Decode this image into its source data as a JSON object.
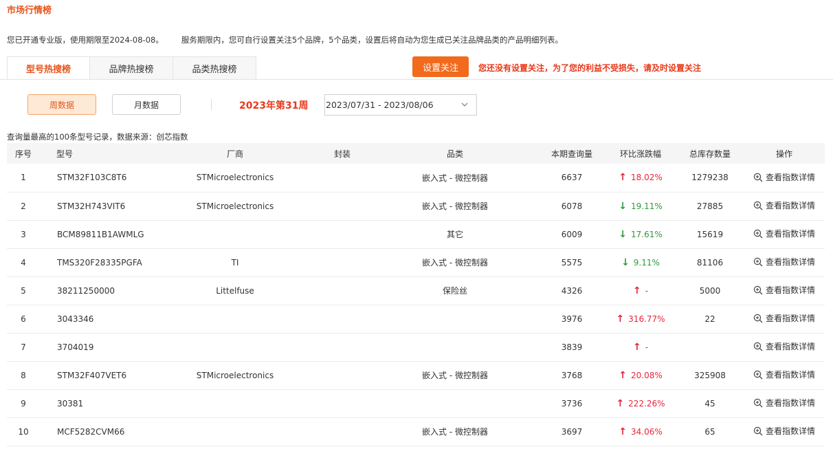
{
  "page_title": "市场行情榜",
  "notice": {
    "left": "您已开通专业版，使用期限至2024-08-08。",
    "right": "服务期限内，您可自行设置关注5个品牌，5个品类，设置后将自动为您生成已关注品牌品类的产品明细列表。"
  },
  "tabs": [
    "型号热搜榜",
    "品牌热搜榜",
    "品类热搜榜"
  ],
  "follow": {
    "button_label": "设置关注",
    "warning": "您还没有设置关注，为了您的利益不受损失，请及时设置关注"
  },
  "period": {
    "week_label": "周数据",
    "month_label": "月数据",
    "current_week": "2023年第31周",
    "date_range": "2023/07/31 - 2023/08/06"
  },
  "source_note": "查询量最高的100条型号记录，数据来源：创芯指数",
  "table": {
    "headers": [
      "序号",
      "型号",
      "厂商",
      "封装",
      "品类",
      "本期查询量",
      "环比涨跌幅",
      "总库存数量",
      "操作"
    ],
    "action_label": "查看指数详情",
    "rows": [
      {
        "rank": "1",
        "model": "STM32F103C8T6",
        "maker": "STMicroelectronics",
        "pkg": "",
        "category": "嵌入式 - 微控制器",
        "queries": "6637",
        "dir": "up",
        "change": "18.02%",
        "stock": "1279238"
      },
      {
        "rank": "2",
        "model": "STM32H743VIT6",
        "maker": "STMicroelectronics",
        "pkg": "",
        "category": "嵌入式 - 微控制器",
        "queries": "6078",
        "dir": "down",
        "change": "19.11%",
        "stock": "27885"
      },
      {
        "rank": "3",
        "model": "BCM89811B1AWMLG",
        "maker": "",
        "pkg": "",
        "category": "其它",
        "queries": "6009",
        "dir": "down",
        "change": "17.61%",
        "stock": "15619"
      },
      {
        "rank": "4",
        "model": "TMS320F28335PGFA",
        "maker": "TI",
        "pkg": "",
        "category": "嵌入式 - 微控制器",
        "queries": "5575",
        "dir": "down",
        "change": "9.11%",
        "stock": "81106"
      },
      {
        "rank": "5",
        "model": "38211250000",
        "maker": "Littelfuse",
        "pkg": "",
        "category": "保险丝",
        "queries": "4326",
        "dir": "up",
        "change": "-",
        "stock": "5000"
      },
      {
        "rank": "6",
        "model": "3043346",
        "maker": "",
        "pkg": "",
        "category": "",
        "queries": "3976",
        "dir": "up",
        "change": "316.77%",
        "stock": "22"
      },
      {
        "rank": "7",
        "model": "3704019",
        "maker": "",
        "pkg": "",
        "category": "",
        "queries": "3839",
        "dir": "up",
        "change": "-",
        "stock": ""
      },
      {
        "rank": "8",
        "model": "STM32F407VET6",
        "maker": "STMicroelectronics",
        "pkg": "",
        "category": "嵌入式 - 微控制器",
        "queries": "3768",
        "dir": "up",
        "change": "20.08%",
        "stock": "325908"
      },
      {
        "rank": "9",
        "model": "30381",
        "maker": "",
        "pkg": "",
        "category": "",
        "queries": "3736",
        "dir": "up",
        "change": "222.26%",
        "stock": "45"
      },
      {
        "rank": "10",
        "model": "MCF5282CVM66",
        "maker": "",
        "pkg": "",
        "category": "嵌入式 - 微控制器",
        "queries": "3697",
        "dir": "up",
        "change": "34.06%",
        "stock": "65"
      }
    ]
  }
}
